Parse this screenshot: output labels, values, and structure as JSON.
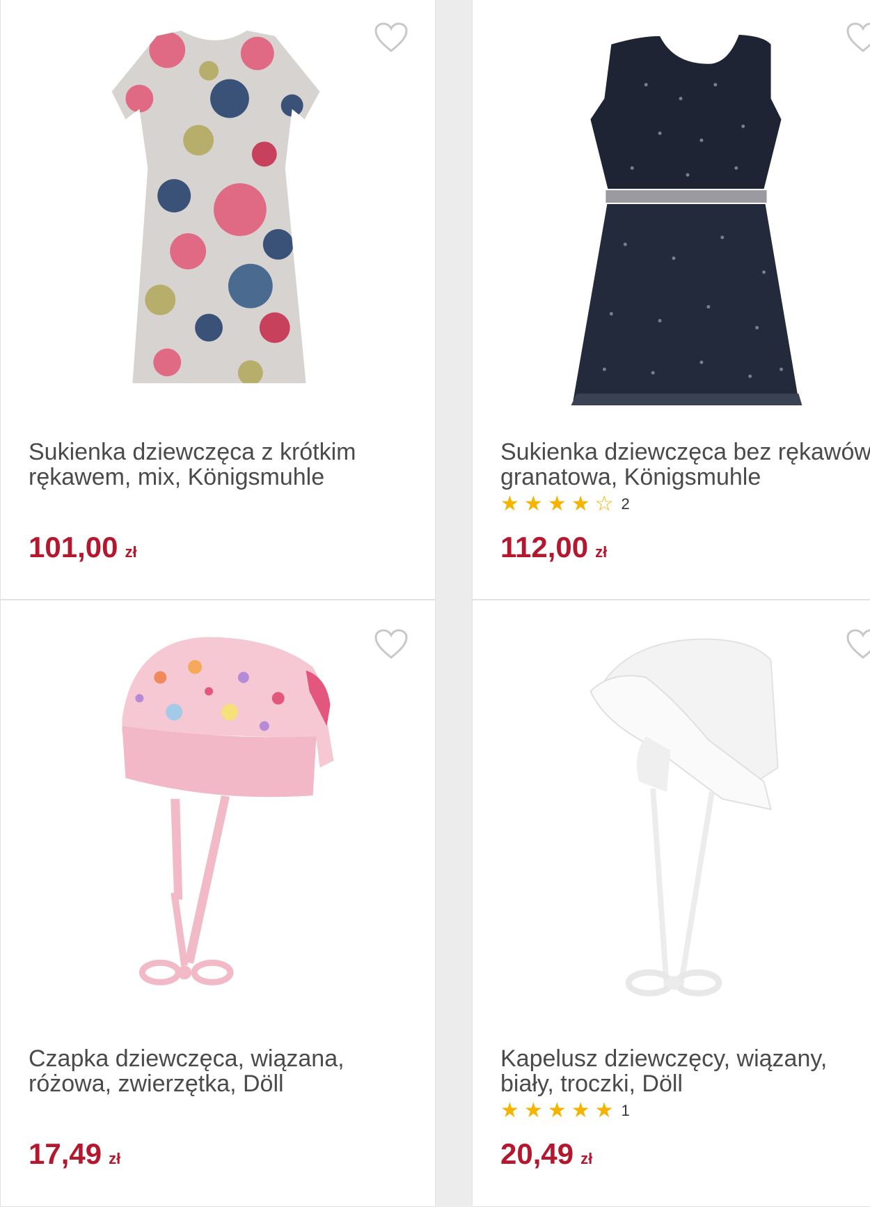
{
  "products": [
    {
      "title_line1": "Sukienka dziewczęca z krótkim",
      "title_line2": "rękawem, mix, Königsmuhle",
      "price": "101,00",
      "currency": "zł",
      "rating_count": "",
      "stars_filled": 0
    },
    {
      "title_line1": "Sukienka dziewczęca bez rękawów,",
      "title_line2": "granatowa, Königsmuhle",
      "price": "112,00",
      "currency": "zł",
      "rating_count": "2",
      "stars_filled": 4
    },
    {
      "title_line1": "Czapka dziewczęca, wiązana,",
      "title_line2": "różowa, zwierzętka, Döll",
      "price": "17,49",
      "currency": "zł",
      "rating_count": "",
      "stars_filled": 0
    },
    {
      "title_line1": "Kapelusz dziewczęcy, wiązany,",
      "title_line2": "biały, troczki, Döll",
      "price": "20,49",
      "currency": "zł",
      "rating_count": "1",
      "stars_filled": 5
    }
  ],
  "icons": {
    "favorite": "heart-outline-icon",
    "star_full": "star-filled-icon",
    "star_empty": "star-outline-icon"
  },
  "colors": {
    "price": "#b4182e",
    "star": "#f4b400",
    "text": "#4a4a4a"
  }
}
